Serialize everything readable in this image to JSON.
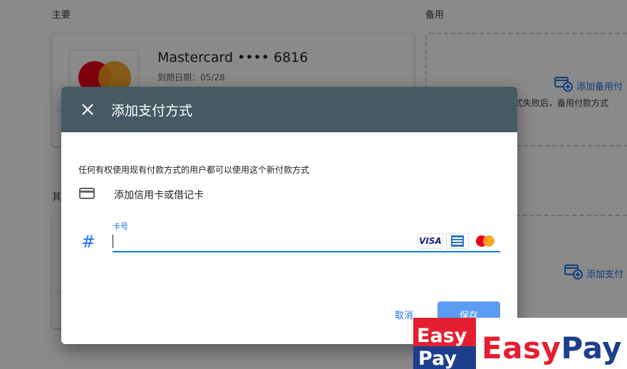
{
  "background": {
    "primary_label": "主要",
    "backup_label": "备用",
    "other_label_partial": "其",
    "primary_card": {
      "name": "Mastercard •••• 6816",
      "expiry": "到期日期：05/28"
    },
    "backup_add_link": "添加备用付",
    "backup_desc_partial": "式失败后，备用付款方式",
    "other_add_link": "添加支付"
  },
  "dialog": {
    "title": "添加支付方式",
    "description": "任何有权使用现有付款方式的用户都可以使用这个新付款方式",
    "option_label": "添加信用卡或借记卡",
    "card_field": {
      "label": "卡号",
      "value": "",
      "placeholder": ""
    },
    "card_brands": [
      "VISA",
      "American Express",
      "Mastercard"
    ],
    "cancel_label": "取消",
    "save_label": "保存"
  },
  "easypay_badge": {
    "square_top": "Easy",
    "square_bottom": "Pay",
    "word_easy": "Easy",
    "word_pay": "Pay"
  },
  "colors": {
    "header": "#455a64",
    "accent": "#1a73e8",
    "save_button": "#5b9bf2",
    "easypay_red": "#e41e30",
    "easypay_blue": "#1d3e8c"
  }
}
